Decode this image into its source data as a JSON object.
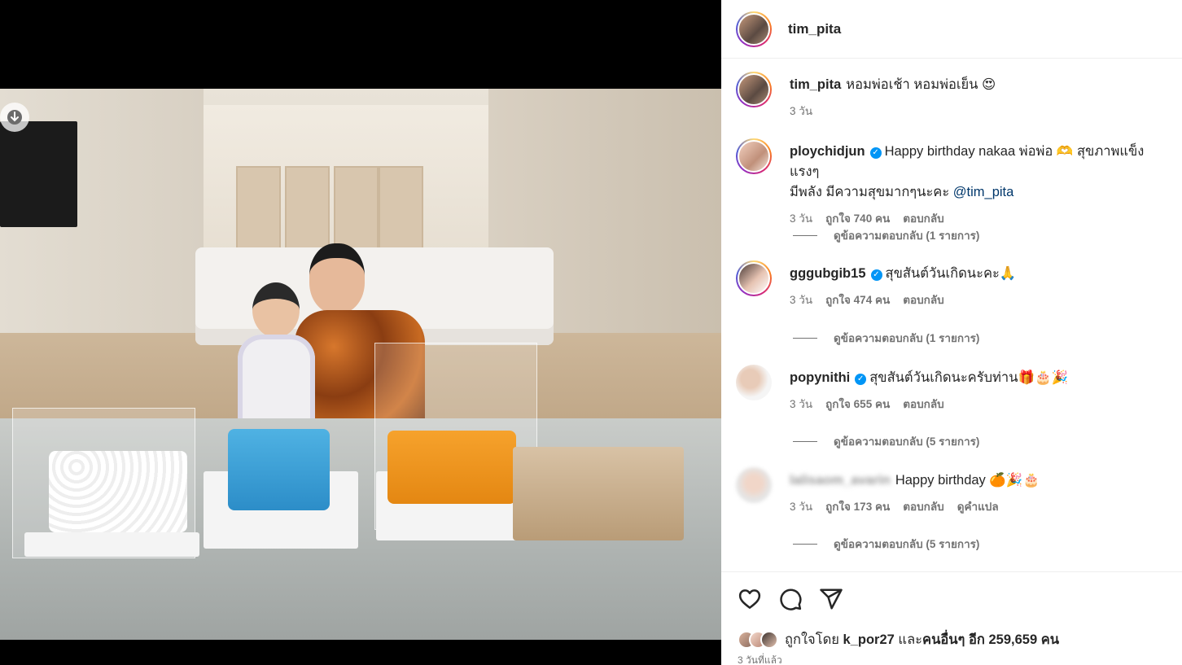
{
  "post": {
    "author": "tim_pita",
    "caption_text": "หอมพ่อเช้า หอมพ่อเย็น 😍",
    "caption_time": "3 วัน"
  },
  "comments": [
    {
      "user": "ploychidjun",
      "verified": true,
      "text_line1": "Happy birthday nakaa พ่อพ่อ 🫶 สุขภาพแข็งแรงๆ",
      "text_line2_prefix": "มีพลัง มีความสุขมากๆนะคะ ",
      "mention": "@tim_pita",
      "time": "3 วัน",
      "likes": "ถูกใจ 740 คน",
      "reply": "ตอบกลับ",
      "view_replies": "ดูข้อความตอบกลับ (1 รายการ)"
    },
    {
      "user": "gggubgib15",
      "verified": true,
      "text": "สุขสันต์วันเกิดนะคะ🙏",
      "time": "3 วัน",
      "likes": "ถูกใจ 474 คน",
      "reply": "ตอบกลับ",
      "view_replies": "ดูข้อความตอบกลับ (1 รายการ)"
    },
    {
      "user": "popynithi",
      "verified": true,
      "text": "สุขสันต์วันเกิดนะครับท่าน🎁🎂🎉",
      "time": "3 วัน",
      "likes": "ถูกใจ 655 คน",
      "reply": "ตอบกลับ",
      "view_replies": "ดูข้อความตอบกลับ (5 รายการ)"
    },
    {
      "user": "lalisaom_avarin",
      "verified": false,
      "text": "Happy birthday 🍊🎉🎂",
      "time": "3 วัน",
      "likes": "ถูกใจ 173 คน",
      "reply": "ตอบกลับ",
      "translate": "ดูคำแปล",
      "view_replies": "ดูข้อความตอบกลับ (5 รายการ)"
    }
  ],
  "footer": {
    "liked_by_prefix": "ถูกใจโดย ",
    "liked_by_user": "k_por27",
    "liked_by_mid": " และ",
    "liked_by_others": "คนอื่นๆ อีก 259,659 คน",
    "date": "3 วันที่แล้ว"
  },
  "icons": [
    "download-icon",
    "heart-icon",
    "comment-icon",
    "share-icon",
    "verified-icon"
  ],
  "colors": {
    "verified": "#0095f6",
    "mention": "#00376b",
    "meta": "#737373"
  }
}
